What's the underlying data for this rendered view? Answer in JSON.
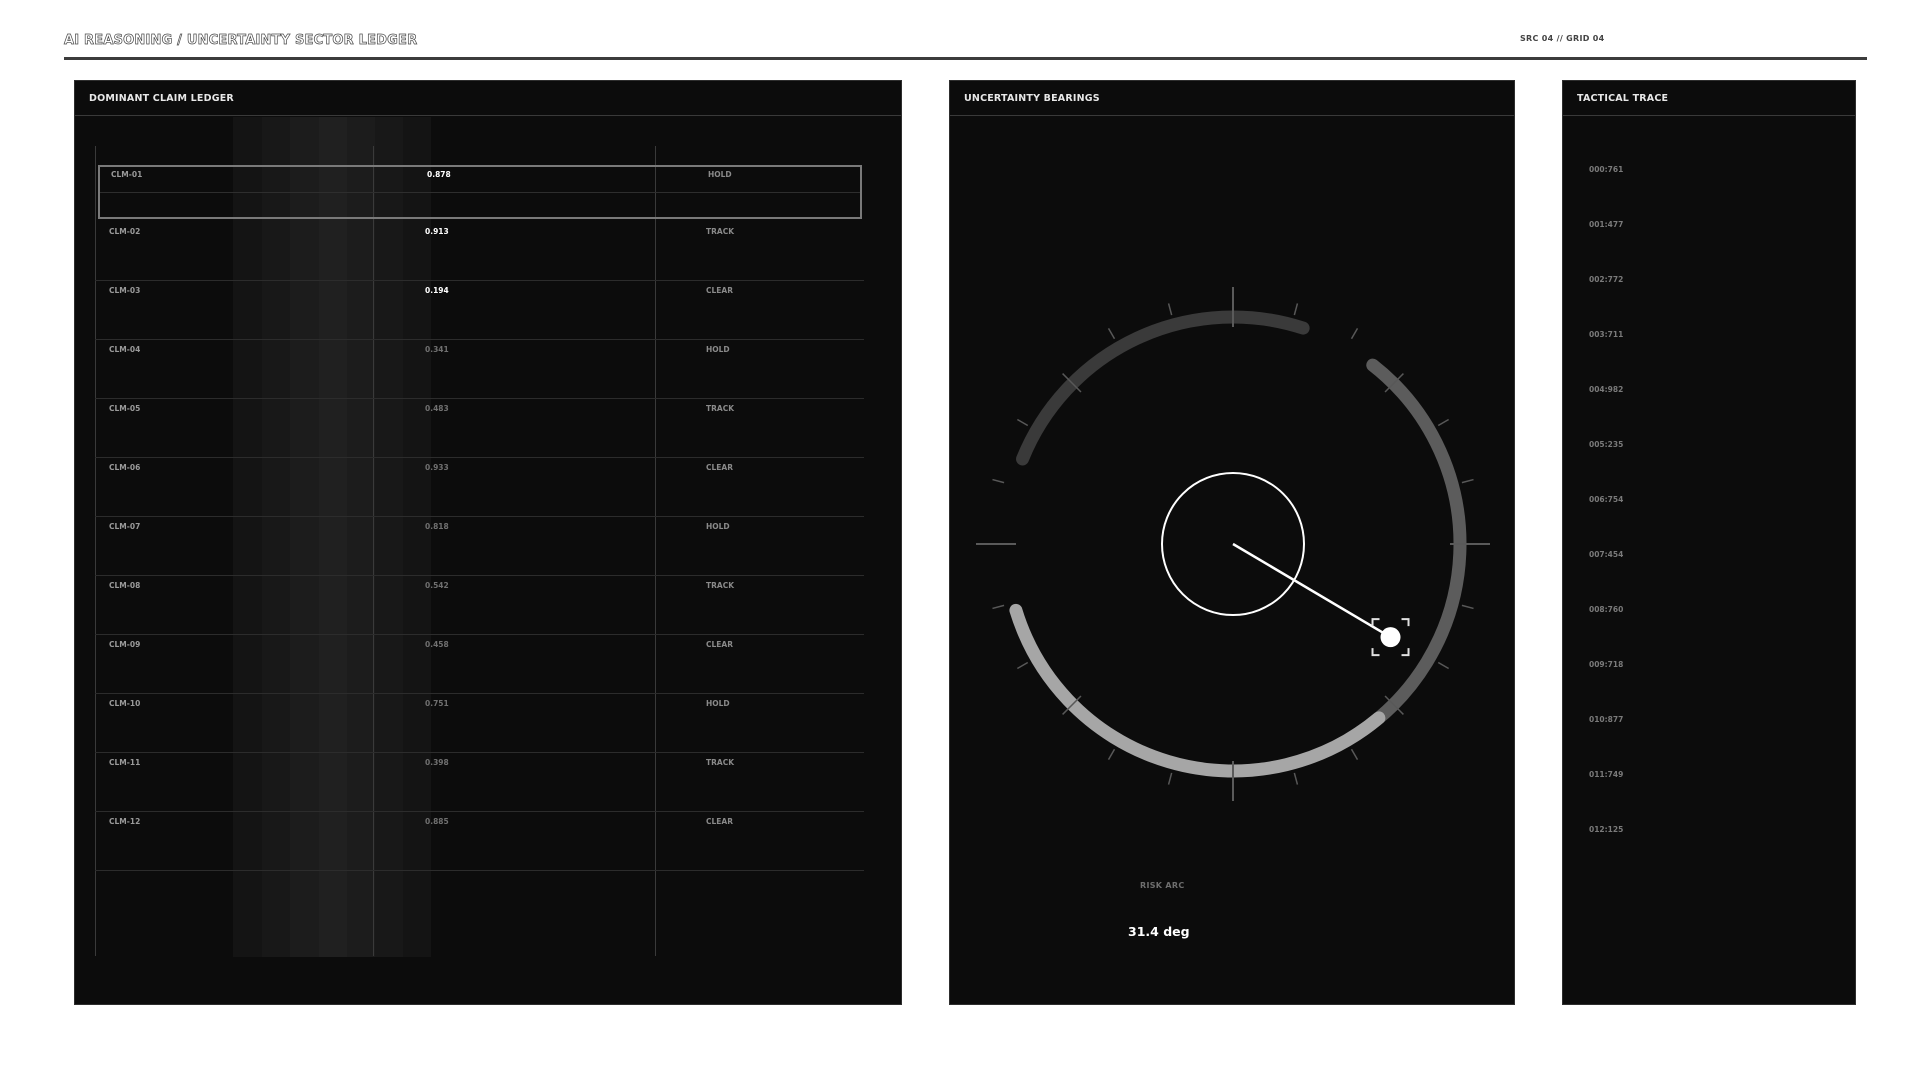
{
  "header": {
    "title": "AI REASONING / UNCERTAINTY SECTOR LEDGER",
    "meta": "SRC 04 // GRID 04"
  },
  "ledger": {
    "title": "DOMINANT CLAIM LEDGER",
    "rows": [
      {
        "id": "CLM-01",
        "value": "0.878",
        "status": "HOLD",
        "highlight": true,
        "selected": true
      },
      {
        "id": "CLM-02",
        "value": "0.913",
        "status": "TRACK",
        "highlight": true
      },
      {
        "id": "CLM-03",
        "value": "0.194",
        "status": "CLEAR",
        "highlight": true
      },
      {
        "id": "CLM-04",
        "value": "0.341",
        "status": "HOLD"
      },
      {
        "id": "CLM-05",
        "value": "0.483",
        "status": "TRACK"
      },
      {
        "id": "CLM-06",
        "value": "0.933",
        "status": "CLEAR"
      },
      {
        "id": "CLM-07",
        "value": "0.818",
        "status": "HOLD"
      },
      {
        "id": "CLM-08",
        "value": "0.542",
        "status": "TRACK"
      },
      {
        "id": "CLM-09",
        "value": "0.458",
        "status": "CLEAR"
      },
      {
        "id": "CLM-10",
        "value": "0.751",
        "status": "HOLD"
      },
      {
        "id": "CLM-11",
        "value": "0.398",
        "status": "TRACK"
      },
      {
        "id": "CLM-12",
        "value": "0.885",
        "status": "CLEAR"
      }
    ]
  },
  "bearings": {
    "title": "UNCERTAINTY BEARINGS",
    "risk_label": "RISK ARC",
    "risk_value": "31.4 deg",
    "bearing_deg": 31.4
  },
  "trace": {
    "title": "TACTICAL TRACE",
    "items": [
      "000:761",
      "001:477",
      "002:772",
      "003:711",
      "004:982",
      "005:235",
      "006:754",
      "007:454",
      "008:760",
      "009:718",
      "010:877",
      "011:749",
      "012:125"
    ]
  },
  "colors": {
    "background": "#0c0c0c",
    "accent": "#ffffff",
    "arc_dark": "#3a3a3a",
    "arc_mid": "#5c5c5c",
    "arc_light": "#a6a6a6"
  }
}
